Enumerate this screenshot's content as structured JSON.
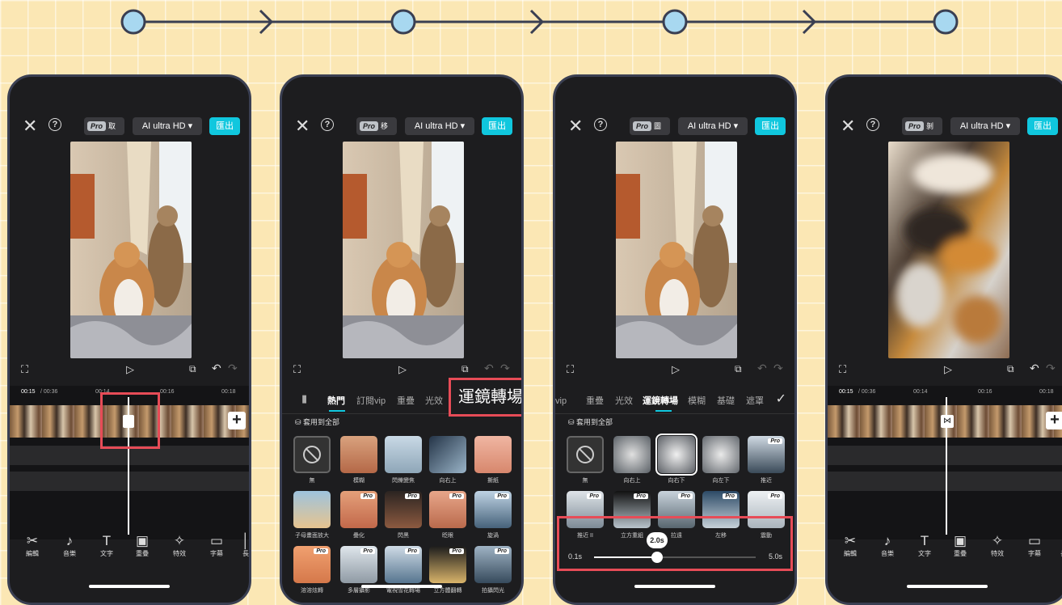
{
  "topbar": {
    "pro_tag": "Pro",
    "pro_labels": [
      "取",
      "移",
      "圖",
      "剝"
    ],
    "quality": "AI ultra HD ▾",
    "export": "匯出"
  },
  "controls": {
    "full": "⛶",
    "play": "▷",
    "keyframe": "⧉",
    "undo": "↶",
    "redo": "↷"
  },
  "timeline": {
    "ticks": [
      "00:15",
      "/ 00:36",
      "00:14",
      "00:16",
      "00:18"
    ]
  },
  "toolbar": [
    {
      "icon": "✂",
      "label": "編輯"
    },
    {
      "icon": "♪",
      "label": "音樂"
    },
    {
      "icon": "T",
      "label": "文字"
    },
    {
      "icon": "▣",
      "label": "重疊"
    },
    {
      "icon": "✧",
      "label": "特效"
    },
    {
      "icon": "▭",
      "label": "字幕"
    },
    {
      "icon": "│",
      "label": "長"
    }
  ],
  "phone2": {
    "tabs": [
      "熱門",
      "訂閱vip",
      "重疊",
      "光效"
    ],
    "callout": "運鏡轉場",
    "apply_all": "套用到全部",
    "row1": [
      "無",
      "模糊",
      "閃爍變焦",
      "向右上",
      "撕紙"
    ],
    "row2": [
      "子母畫面放大",
      "疊化",
      "閃黑",
      "眨眼",
      "旋渦"
    ],
    "row3": [
      "溶溶炫轉",
      "多層攝影",
      "電視雪花轉場",
      "立方體翻轉",
      "拍攝閃光"
    ]
  },
  "phone3": {
    "tabs": [
      "訂閱vip",
      "重疊",
      "光效",
      "運鏡轉場",
      "模糊",
      "基礎",
      "遮罩"
    ],
    "apply_all": "套用到全部",
    "row1": [
      "無",
      "向右上",
      "向右下",
      "向左下",
      "推近"
    ],
    "row2": [
      "推近 II",
      "立方重組",
      "拉遠",
      "左移",
      "震動"
    ],
    "slider": {
      "min": "0.1s",
      "max": "5.0s",
      "value": "2.0s",
      "fraction": 0.39
    }
  },
  "pro_badge": "Pro"
}
